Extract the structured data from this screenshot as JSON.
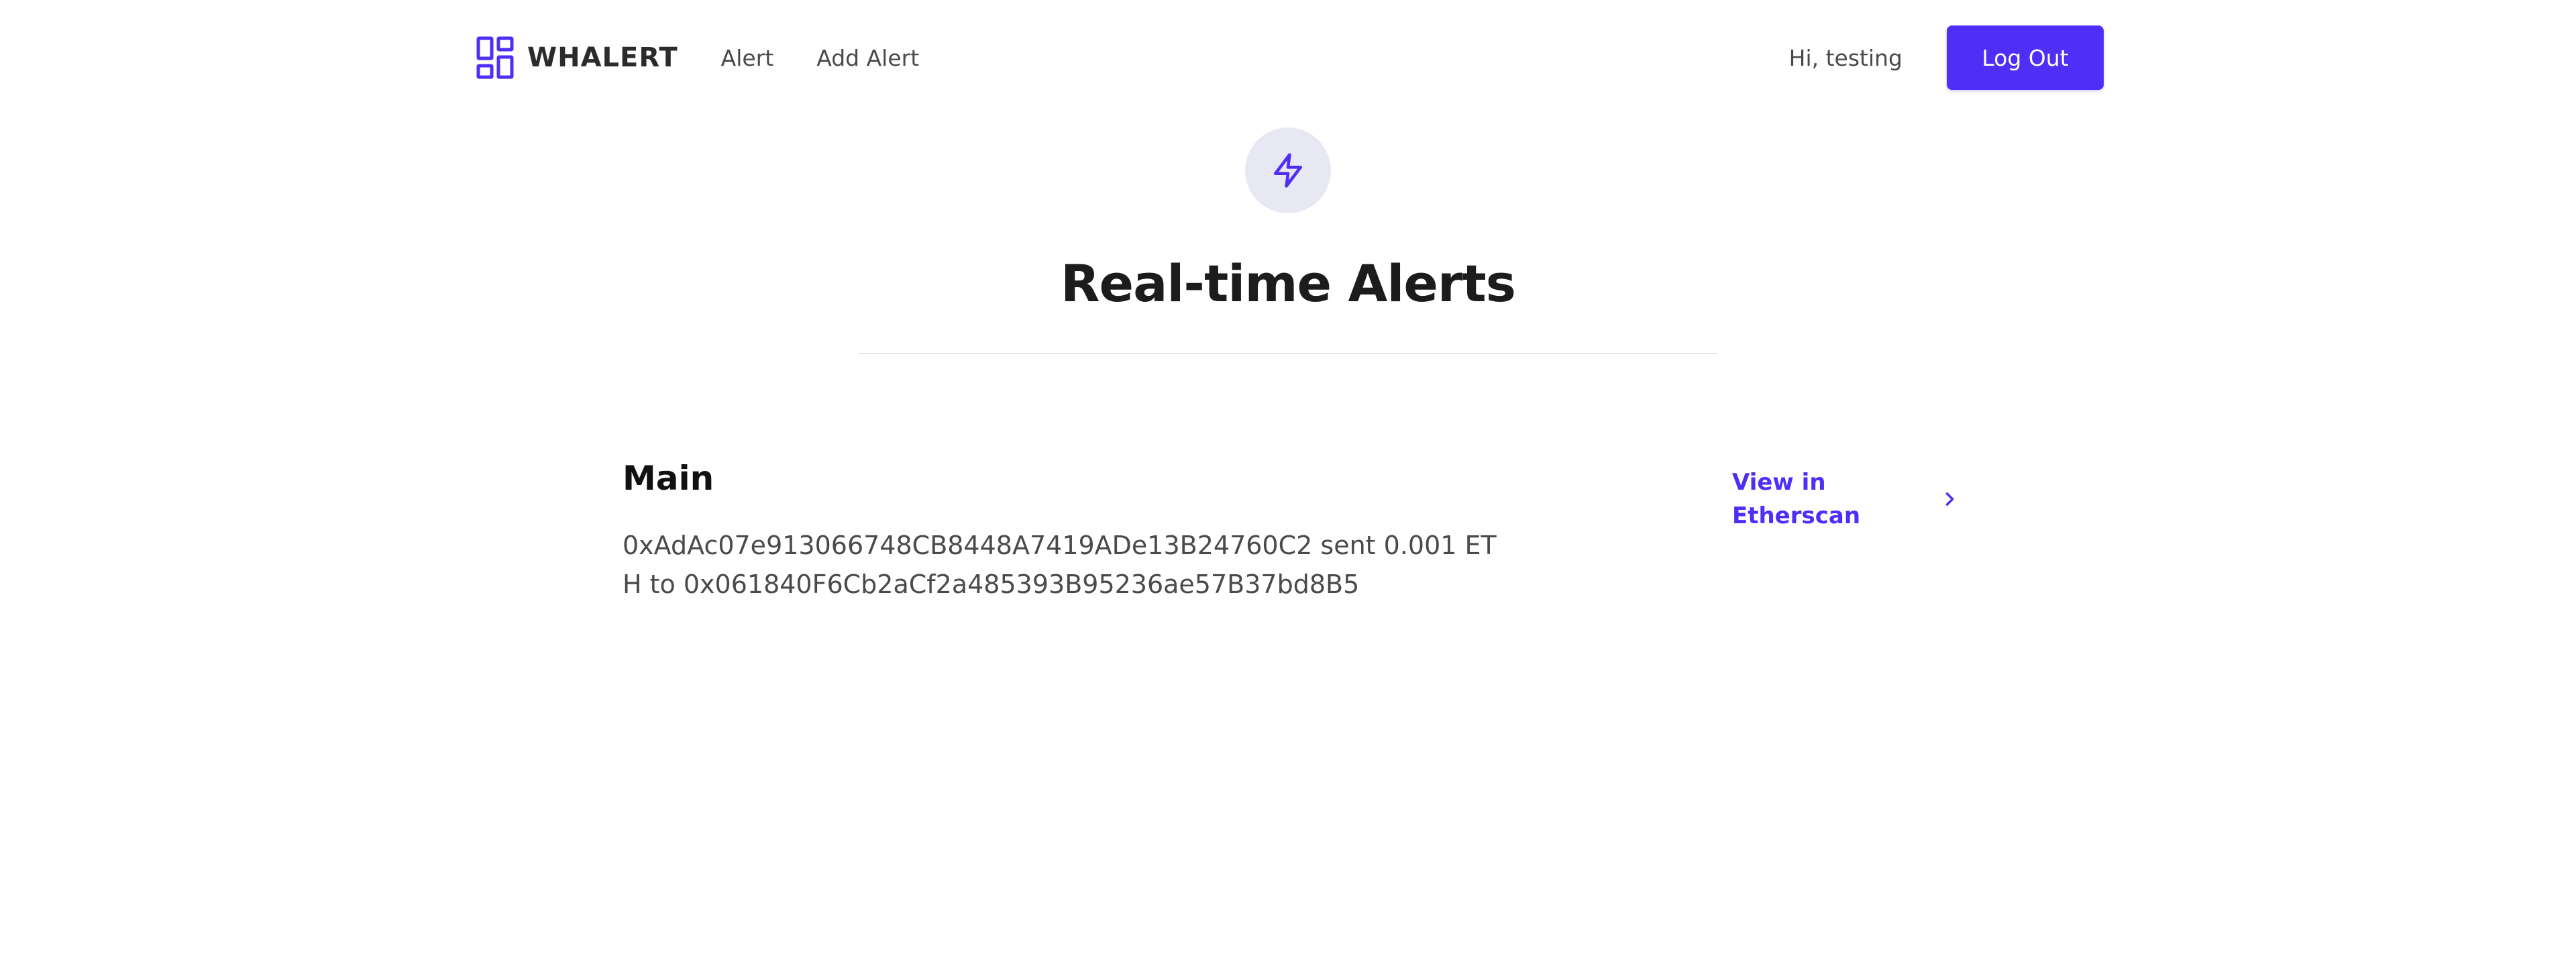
{
  "nav": {
    "brand": "WHALERT",
    "links": [
      "Alert",
      "Add Alert"
    ],
    "greeting": "Hi, testing",
    "logout_label": "Log Out"
  },
  "hero": {
    "icon": "lightning-icon",
    "title": "Real-time Alerts"
  },
  "alerts": [
    {
      "title": "Main",
      "message": "0xAdAc07e913066748CB8448A7419ADe13B24760C2 sent 0.001 ETH to 0x061840F6Cb2aCf2a485393B95236ae57B37bd8B5",
      "link_label": "View in Etherscan",
      "link_icon": "chevron-right-icon"
    }
  ],
  "colors": {
    "accent": "#4f2ef5",
    "icon_bg": "#e8e8f4",
    "text_dark": "#1c1c1c",
    "text_muted": "#4a4a4a",
    "divider": "#e3e3e6"
  }
}
